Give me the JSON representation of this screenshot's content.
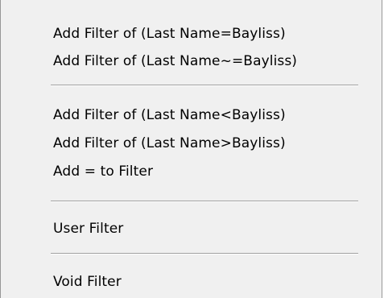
{
  "menu": {
    "items": [
      {
        "label": "Add Filter of (Last Name=Bayliss)"
      },
      {
        "label": "Add Filter of (Last Name~=Bayliss)"
      },
      {
        "label": "Add Filter of (Last Name<Bayliss)"
      },
      {
        "label": "Add Filter of (Last Name>Bayliss)"
      },
      {
        "label": "Add = to Filter"
      },
      {
        "label": "User Filter"
      },
      {
        "label": "Void Filter"
      }
    ]
  }
}
